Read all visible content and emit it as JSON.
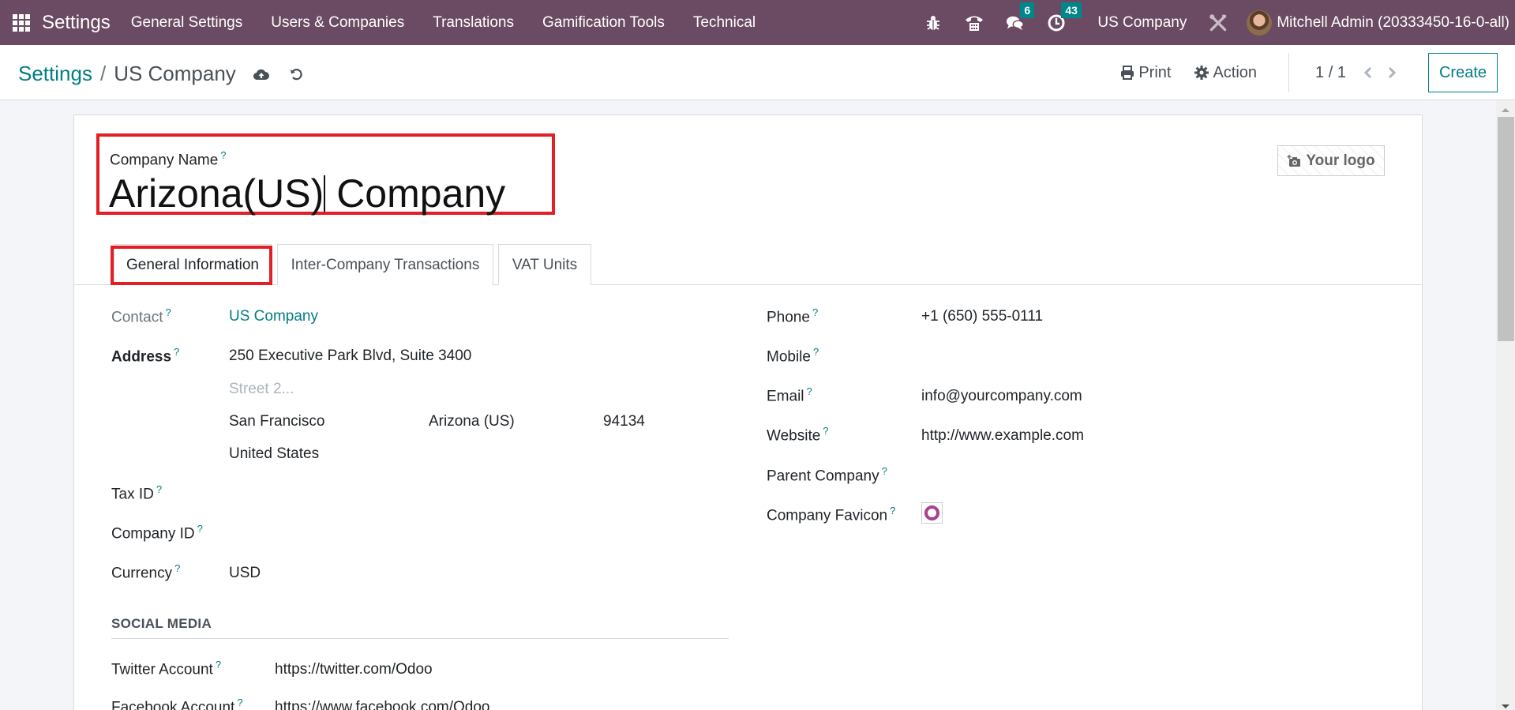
{
  "navbar": {
    "app_name": "Settings",
    "menu": [
      "General Settings",
      "Users & Companies",
      "Translations",
      "Gamification Tools",
      "Technical"
    ],
    "messages_count": "6",
    "activities_count": "43",
    "company": "US Company",
    "user": "Mitchell Admin (20333450-16-0-all)"
  },
  "control_panel": {
    "breadcrumb_parent": "Settings",
    "breadcrumb_separator": "/",
    "breadcrumb_current": "US Company",
    "print_label": "Print",
    "action_label": "Action",
    "pager": "1 / 1",
    "create_label": "Create"
  },
  "form": {
    "company_name_label": "Company Name",
    "company_name_before_caret": "Arizona(US)",
    "company_name_after_caret": " Company",
    "logo_label": "Your logo",
    "tabs": [
      "General Information",
      "Inter-Company Transactions",
      "VAT Units"
    ],
    "left": {
      "contact_label": "Contact",
      "contact_value": "US Company",
      "address_label": "Address",
      "street": "250 Executive Park Blvd, Suite 3400",
      "street2_placeholder": "Street 2...",
      "city": "San Francisco",
      "state": "Arizona (US)",
      "zip": "94134",
      "country": "United States",
      "tax_id_label": "Tax ID",
      "company_id_label": "Company ID",
      "currency_label": "Currency",
      "currency_value": "USD"
    },
    "right": {
      "phone_label": "Phone",
      "phone_value": "+1 (650) 555-0111",
      "mobile_label": "Mobile",
      "email_label": "Email",
      "email_value": "info@yourcompany.com",
      "website_label": "Website",
      "website_value": "http://www.example.com",
      "parent_company_label": "Parent Company",
      "favicon_label": "Company Favicon"
    },
    "social_media": {
      "title": "SOCIAL MEDIA",
      "twitter_label": "Twitter Account",
      "twitter_value": "https://twitter.com/Odoo",
      "facebook_label": "Facebook Account",
      "facebook_value": "https://www.facebook.com/Odoo"
    },
    "help_mark": "?"
  }
}
